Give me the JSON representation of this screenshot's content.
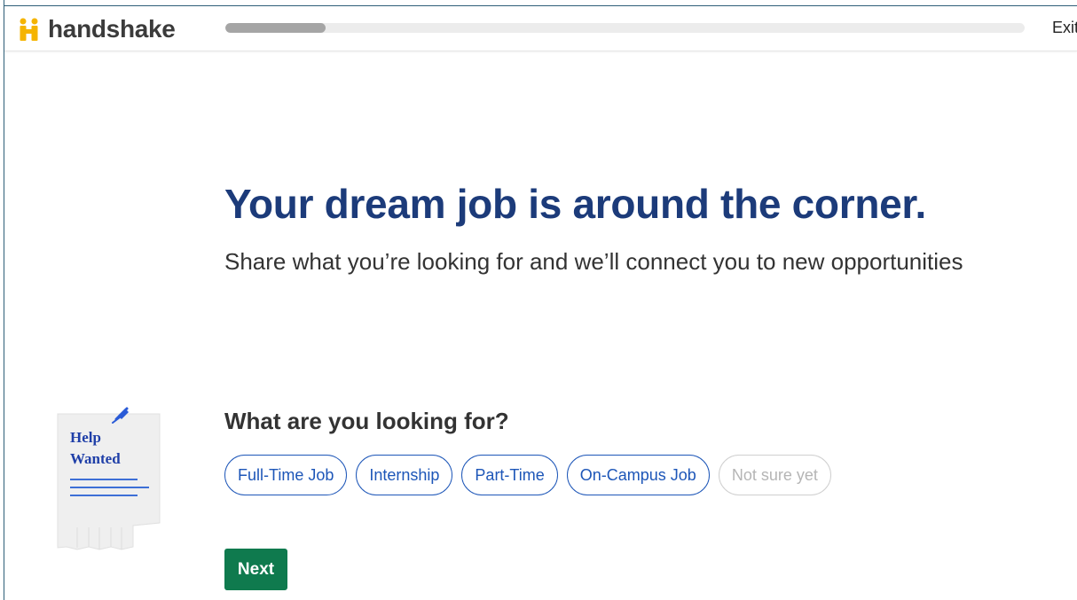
{
  "header": {
    "logo_text": "handshake",
    "progress_fraction": 0.125,
    "exit_label": "Exit"
  },
  "main": {
    "headline": "Your dream job is around the corner.",
    "subhead": "Share what you’re looking for and we’ll connect you to new opportunities"
  },
  "illustration": {
    "line1": "Help",
    "line2": "Wanted"
  },
  "question": {
    "label": "What are you looking for?",
    "options": [
      {
        "label": "Full-Time Job",
        "enabled": true
      },
      {
        "label": "Internship",
        "enabled": true
      },
      {
        "label": "Part-Time",
        "enabled": true
      },
      {
        "label": "On-Campus Job",
        "enabled": true
      },
      {
        "label": "Not sure yet",
        "enabled": false
      }
    ]
  },
  "actions": {
    "next_label": "Next"
  },
  "colors": {
    "brand_yellow": "#f5b400",
    "headline_navy": "#1c3b7a",
    "chip_blue": "#1d56b8",
    "next_green": "#0f7a4e"
  }
}
